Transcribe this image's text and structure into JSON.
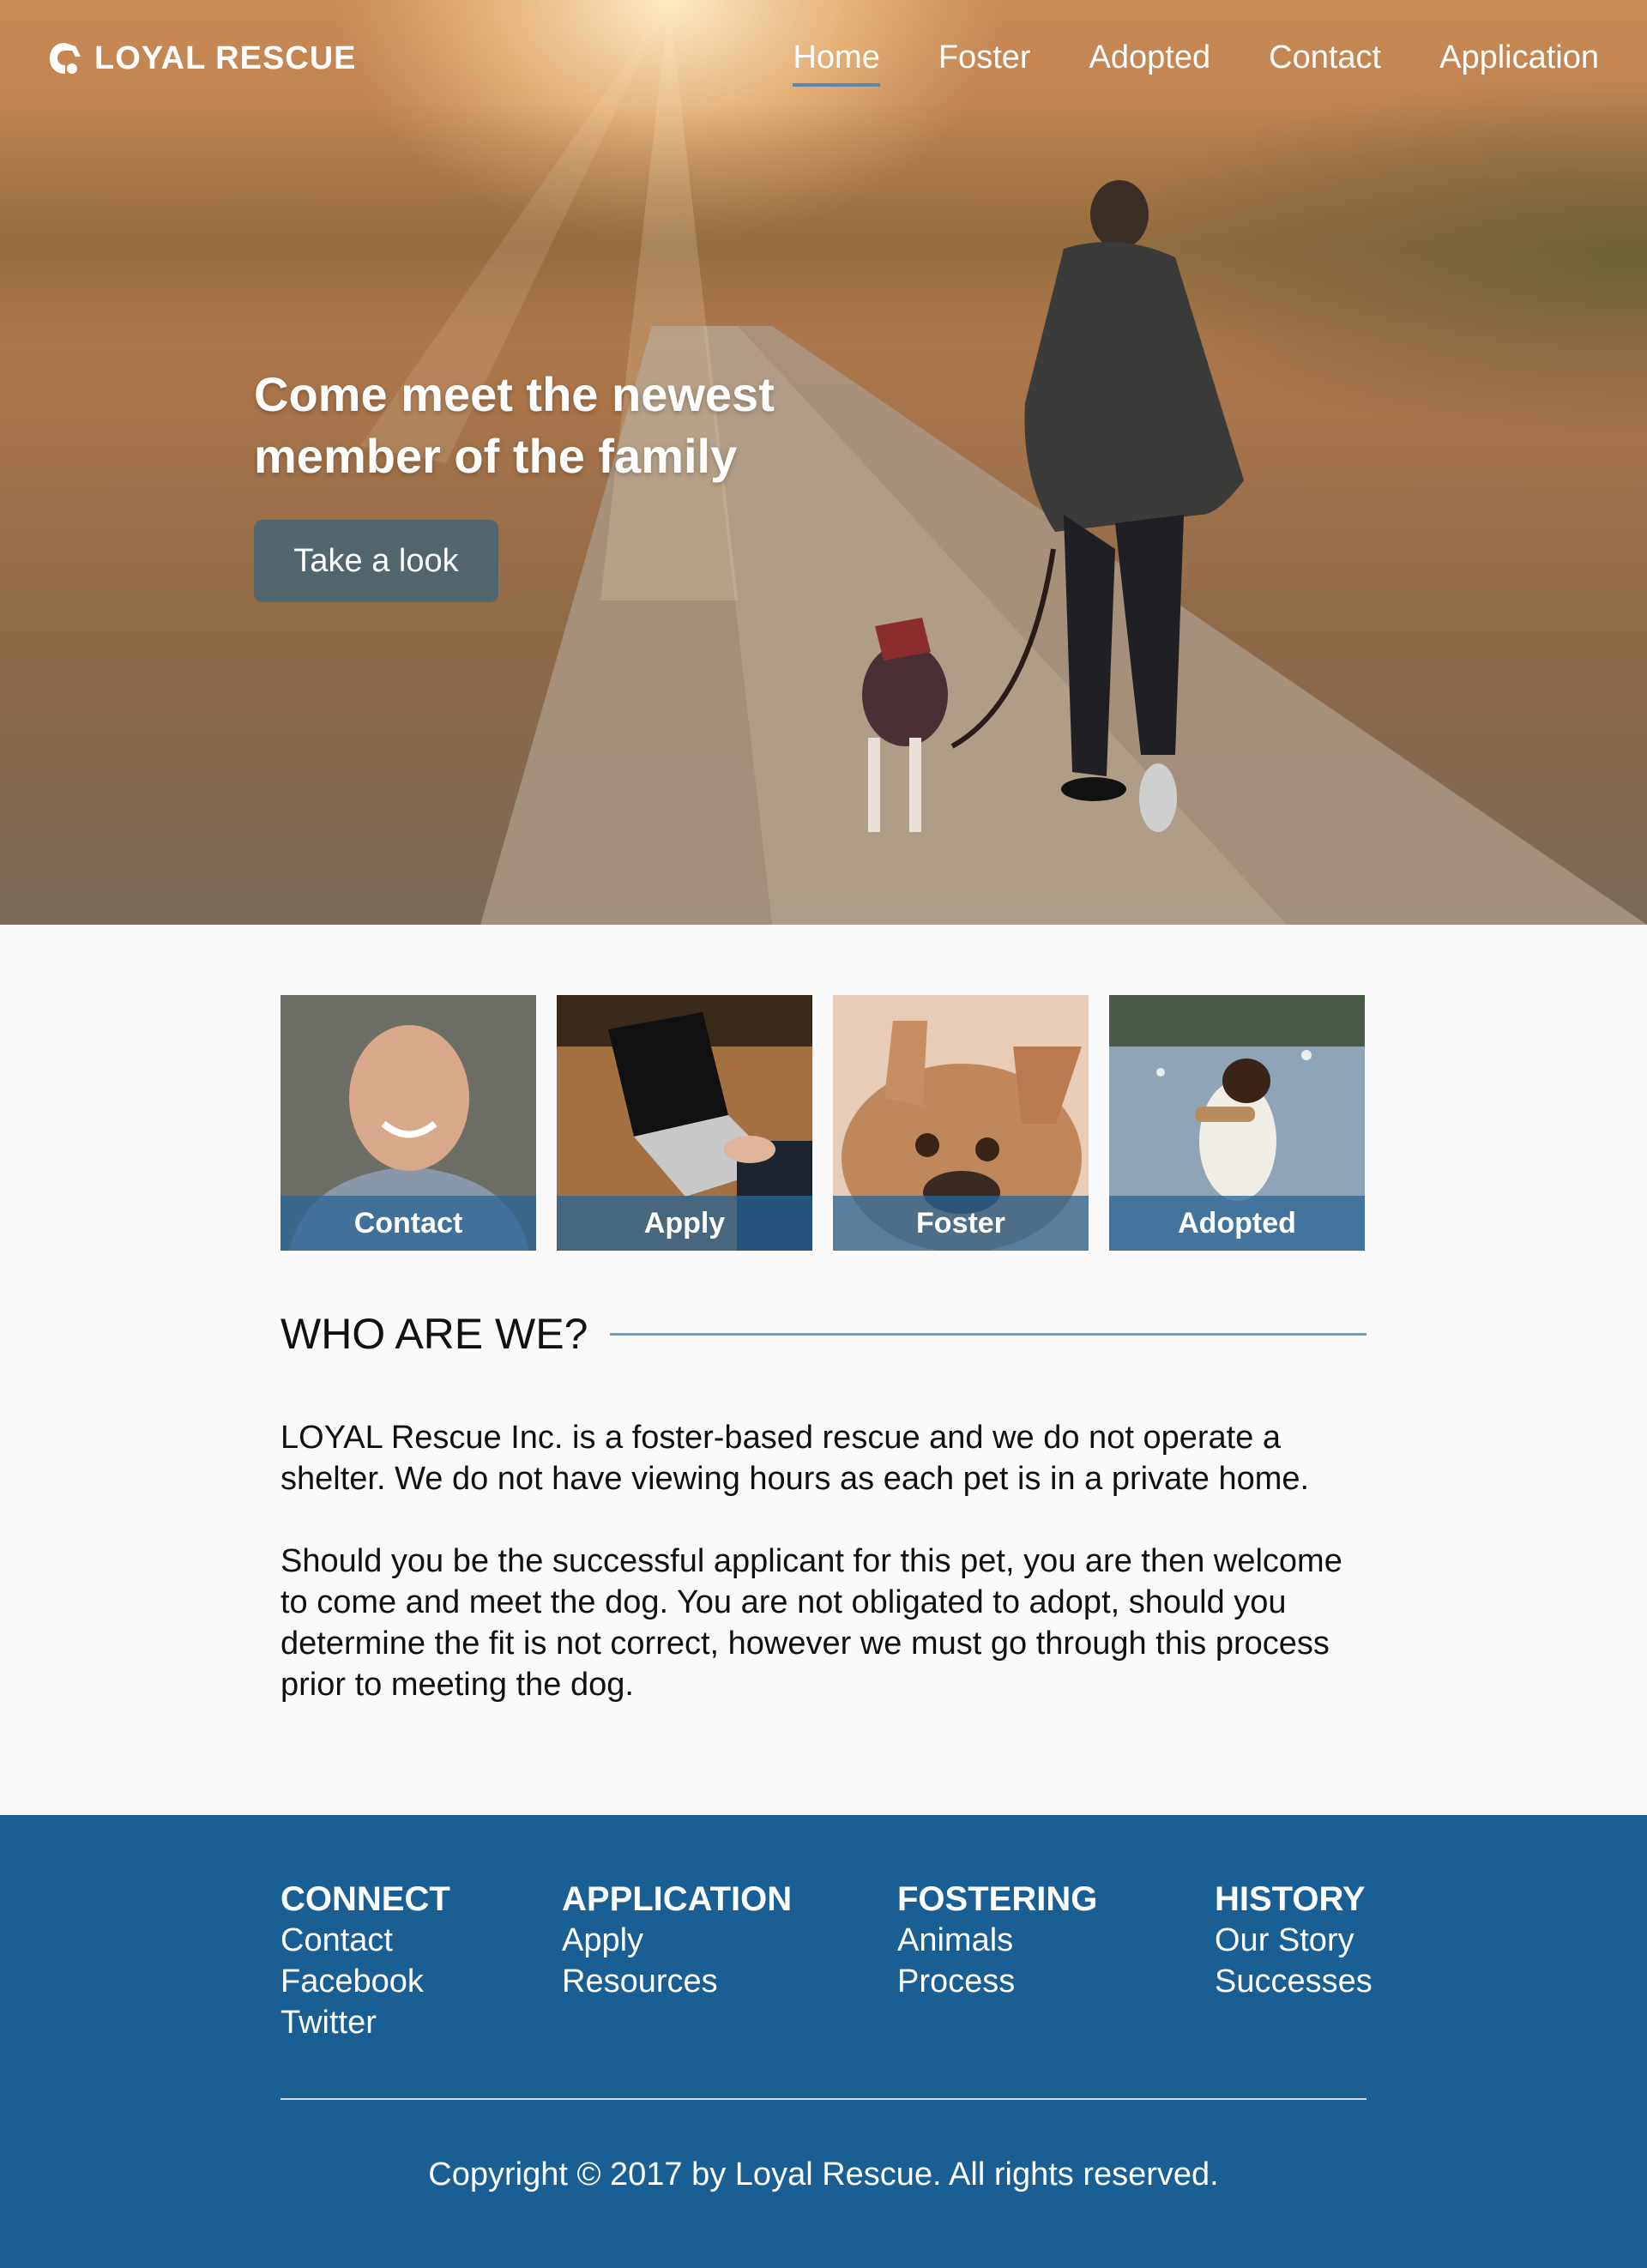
{
  "header": {
    "brand": "LOYAL RESCUE",
    "logo_icon": "dog-head-icon",
    "nav": [
      {
        "label": "Home",
        "active": true
      },
      {
        "label": "Foster",
        "active": false
      },
      {
        "label": "Adopted",
        "active": false
      },
      {
        "label": "Contact",
        "active": false
      },
      {
        "label": "Application",
        "active": false
      }
    ]
  },
  "hero": {
    "headline": "Come meet the newest member of the family",
    "button_label": "Take a look"
  },
  "tiles": [
    {
      "label": "Contact"
    },
    {
      "label": "Apply"
    },
    {
      "label": "Foster"
    },
    {
      "label": "Adopted"
    }
  ],
  "about": {
    "heading": "WHO ARE WE?",
    "paragraphs": [
      "LOYAL Rescue Inc. is a foster-based rescue and we do not operate a shelter. We do not have viewing hours as each pet is in a private home.",
      "Should you be the successful applicant for this pet, you are then welcome to come and meet the dog. You are not obligated to adopt, should you determine the fit is not correct, however we must go through this process prior to meeting the dog."
    ]
  },
  "footer": {
    "columns": [
      {
        "heading": "CONNECT",
        "links": [
          "Contact",
          "Facebook",
          "Twitter"
        ]
      },
      {
        "heading": "APPLICATION",
        "links": [
          "Apply",
          "Resources"
        ]
      },
      {
        "heading": "FOSTERING",
        "links": [
          "Animals",
          "Process"
        ]
      },
      {
        "heading": "HISTORY",
        "links": [
          "Our Story",
          "Successes"
        ]
      }
    ],
    "copyright": "Copyright © 2017 by Loyal Rescue. All rights reserved."
  },
  "colors": {
    "footer_bg": "#1a5f93",
    "accent": "#5a86b3",
    "tile_caption_bg": "#2a6796",
    "hero_button_bg": "#46647a"
  }
}
